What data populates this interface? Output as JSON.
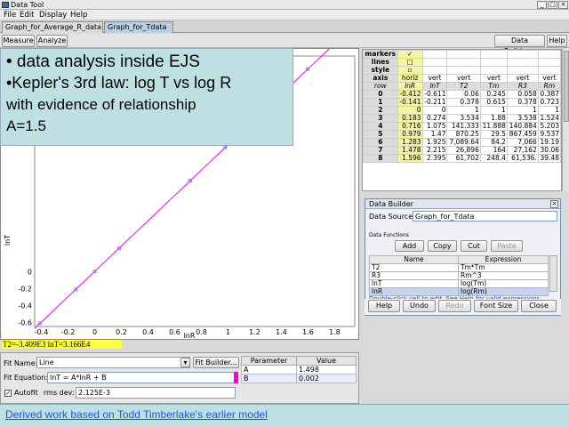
{
  "window": {
    "title": "Data Tool",
    "minimize": "_",
    "maximize": "□",
    "close": "×"
  },
  "menu": [
    "File",
    "Edit",
    "Display",
    "Help"
  ],
  "tabs": [
    {
      "label": "Graph_for_Average_R_data"
    },
    {
      "label": "Graph_for_Tdata"
    }
  ],
  "toolbar": {
    "measure": "Measure",
    "analyze": "Analyze",
    "data_builder": "Data Builder...",
    "help": "Help"
  },
  "overlay": {
    "line1": "• data analysis inside EJS",
    "line2": "•Kepler's 3rd law: log T vs log R",
    "line3": "with evidence of relationship",
    "line4": "A=1.5"
  },
  "chart_data": {
    "type": "scatter",
    "xlabel": "lnR",
    "ylabel": "lnT",
    "xlim": [
      -0.45,
      1.95
    ],
    "ylim": [
      -0.65,
      2.55
    ],
    "x_ticks": [
      "-0.4",
      "-0.2",
      "0",
      "0.2",
      "0.4",
      "0.6",
      "0.8",
      "1",
      "1.2",
      "1.4",
      "1.6",
      "1.8"
    ],
    "y_ticks": [
      "-0.6",
      "-0.4",
      "-0.2",
      "0"
    ],
    "points": [
      {
        "x": -0.412,
        "y": -0.611
      },
      {
        "x": -0.141,
        "y": -0.211
      },
      {
        "x": 0,
        "y": 0
      },
      {
        "x": 0.183,
        "y": 0.274
      },
      {
        "x": 0.716,
        "y": 1.075
      },
      {
        "x": 0.979,
        "y": 1.47
      },
      {
        "x": 1.283,
        "y": 1.925
      },
      {
        "x": 1.478,
        "y": 2.215
      },
      {
        "x": 1.596,
        "y": 2.395
      }
    ],
    "fit": {
      "A": 1.498,
      "B": 0.002
    },
    "series_color": "#ff00ff",
    "grid": true
  },
  "coord_readout": "T2=-3.409E3  lnT=3.166E4",
  "fit": {
    "name_label": "Fit Name:",
    "name_value": "Line",
    "builder": "Fit Builder...",
    "equation_label": "Fit Equation:",
    "equation_value": "lnT = A*lnR + B",
    "autofit": "Autofit",
    "rms_label": "rms dev:",
    "rms_value": "2.125E-3",
    "param_header": "Parameter",
    "value_header": "Value",
    "params": [
      {
        "name": "A",
        "value": "1.498"
      },
      {
        "name": "B",
        "value": "0.002"
      }
    ]
  },
  "table": {
    "attr_rows": [
      {
        "label": "markers",
        "cells": [
          "",
          "✓",
          "",
          "",
          "",
          "",
          ""
        ]
      },
      {
        "label": "lines",
        "cells": [
          "",
          "□",
          "",
          "",
          "",
          "",
          ""
        ]
      },
      {
        "label": "style",
        "cells": [
          "",
          "▫",
          "",
          "",
          "",
          "",
          ""
        ]
      },
      {
        "label": "axis",
        "cells": [
          "",
          "horiz",
          "vert",
          "vert",
          "vert",
          "vert",
          "vert"
        ]
      }
    ],
    "headers": [
      "row",
      "lnR",
      "lnT",
      "T2",
      "Tm",
      "R3",
      "Rm"
    ],
    "rows": [
      [
        "0",
        "-0.412",
        "-0.611",
        "0.06",
        "0.245",
        "0.058",
        "0.387"
      ],
      [
        "1",
        "-0.141",
        "-0.211",
        "0.378",
        "0.615",
        "0.378",
        "0.723"
      ],
      [
        "2",
        "0",
        "0",
        "1",
        "1",
        "1",
        "1"
      ],
      [
        "3",
        "0.183",
        "0.274",
        "3.534",
        "1.88",
        "3.538",
        "1.524"
      ],
      [
        "4",
        "0.716",
        "1.075",
        "141.333",
        "11.888",
        "140.884",
        "5.203"
      ],
      [
        "5",
        "0.979",
        "1.47",
        "870.25",
        "29.5",
        "867.459",
        "9.537"
      ],
      [
        "6",
        "1.283",
        "1.925",
        "7,089.64",
        "84.2",
        "7,066",
        "19.19"
      ],
      [
        "7",
        "1.478",
        "2.215",
        "26,896",
        "164",
        "27,162",
        "30.06"
      ],
      [
        "8",
        "1.596",
        "2.395",
        "61,702",
        "248.4",
        "61,536.",
        "39.48"
      ]
    ]
  },
  "builder": {
    "title": "Data Builder",
    "close": "×",
    "source_label": "Data Source:",
    "source_value": "Graph_for_Tdata",
    "functions_label": "Data Functions",
    "add": "Add",
    "copy": "Copy",
    "cut": "Cut",
    "paste": "Paste",
    "col_name": "Name",
    "col_expr": "Expression",
    "functions": [
      {
        "name": "T2",
        "expr": "Tm*Tm"
      },
      {
        "name": "R3",
        "expr": "Rm^3"
      },
      {
        "name": "lnT",
        "expr": "log(Tm)"
      },
      {
        "name": "lnR",
        "expr": "log(Rm)"
      }
    ],
    "hint": "Double-click cell to edit. See Help for valid expressions.",
    "help": "Help",
    "undo": "Undo",
    "redo": "Redo",
    "font_size": "Font Size",
    "close_btn": "Close"
  },
  "footer": "Derived work based on Todd Timberlake's earlier model"
}
